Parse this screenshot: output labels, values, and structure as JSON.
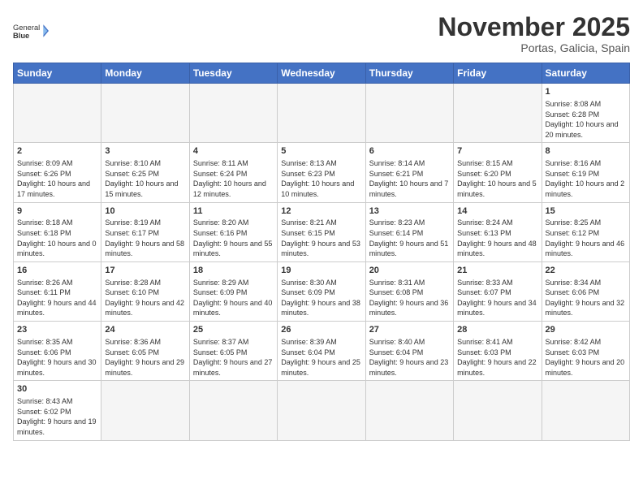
{
  "logo": {
    "text_regular": "General",
    "text_bold": "Blue"
  },
  "header": {
    "month": "November 2025",
    "location": "Portas, Galicia, Spain"
  },
  "days_of_week": [
    "Sunday",
    "Monday",
    "Tuesday",
    "Wednesday",
    "Thursday",
    "Friday",
    "Saturday"
  ],
  "weeks": [
    [
      {
        "day": "",
        "empty": true
      },
      {
        "day": "",
        "empty": true
      },
      {
        "day": "",
        "empty": true
      },
      {
        "day": "",
        "empty": true
      },
      {
        "day": "",
        "empty": true
      },
      {
        "day": "",
        "empty": true
      },
      {
        "day": "1",
        "info": "Sunrise: 8:08 AM\nSunset: 6:28 PM\nDaylight: 10 hours and 20 minutes."
      }
    ],
    [
      {
        "day": "2",
        "info": "Sunrise: 8:09 AM\nSunset: 6:26 PM\nDaylight: 10 hours and 17 minutes."
      },
      {
        "day": "3",
        "info": "Sunrise: 8:10 AM\nSunset: 6:25 PM\nDaylight: 10 hours and 15 minutes."
      },
      {
        "day": "4",
        "info": "Sunrise: 8:11 AM\nSunset: 6:24 PM\nDaylight: 10 hours and 12 minutes."
      },
      {
        "day": "5",
        "info": "Sunrise: 8:13 AM\nSunset: 6:23 PM\nDaylight: 10 hours and 10 minutes."
      },
      {
        "day": "6",
        "info": "Sunrise: 8:14 AM\nSunset: 6:21 PM\nDaylight: 10 hours and 7 minutes."
      },
      {
        "day": "7",
        "info": "Sunrise: 8:15 AM\nSunset: 6:20 PM\nDaylight: 10 hours and 5 minutes."
      },
      {
        "day": "8",
        "info": "Sunrise: 8:16 AM\nSunset: 6:19 PM\nDaylight: 10 hours and 2 minutes."
      }
    ],
    [
      {
        "day": "9",
        "info": "Sunrise: 8:18 AM\nSunset: 6:18 PM\nDaylight: 10 hours and 0 minutes."
      },
      {
        "day": "10",
        "info": "Sunrise: 8:19 AM\nSunset: 6:17 PM\nDaylight: 9 hours and 58 minutes."
      },
      {
        "day": "11",
        "info": "Sunrise: 8:20 AM\nSunset: 6:16 PM\nDaylight: 9 hours and 55 minutes."
      },
      {
        "day": "12",
        "info": "Sunrise: 8:21 AM\nSunset: 6:15 PM\nDaylight: 9 hours and 53 minutes."
      },
      {
        "day": "13",
        "info": "Sunrise: 8:23 AM\nSunset: 6:14 PM\nDaylight: 9 hours and 51 minutes."
      },
      {
        "day": "14",
        "info": "Sunrise: 8:24 AM\nSunset: 6:13 PM\nDaylight: 9 hours and 48 minutes."
      },
      {
        "day": "15",
        "info": "Sunrise: 8:25 AM\nSunset: 6:12 PM\nDaylight: 9 hours and 46 minutes."
      }
    ],
    [
      {
        "day": "16",
        "info": "Sunrise: 8:26 AM\nSunset: 6:11 PM\nDaylight: 9 hours and 44 minutes."
      },
      {
        "day": "17",
        "info": "Sunrise: 8:28 AM\nSunset: 6:10 PM\nDaylight: 9 hours and 42 minutes."
      },
      {
        "day": "18",
        "info": "Sunrise: 8:29 AM\nSunset: 6:09 PM\nDaylight: 9 hours and 40 minutes."
      },
      {
        "day": "19",
        "info": "Sunrise: 8:30 AM\nSunset: 6:09 PM\nDaylight: 9 hours and 38 minutes."
      },
      {
        "day": "20",
        "info": "Sunrise: 8:31 AM\nSunset: 6:08 PM\nDaylight: 9 hours and 36 minutes."
      },
      {
        "day": "21",
        "info": "Sunrise: 8:33 AM\nSunset: 6:07 PM\nDaylight: 9 hours and 34 minutes."
      },
      {
        "day": "22",
        "info": "Sunrise: 8:34 AM\nSunset: 6:06 PM\nDaylight: 9 hours and 32 minutes."
      }
    ],
    [
      {
        "day": "23",
        "info": "Sunrise: 8:35 AM\nSunset: 6:06 PM\nDaylight: 9 hours and 30 minutes."
      },
      {
        "day": "24",
        "info": "Sunrise: 8:36 AM\nSunset: 6:05 PM\nDaylight: 9 hours and 29 minutes."
      },
      {
        "day": "25",
        "info": "Sunrise: 8:37 AM\nSunset: 6:05 PM\nDaylight: 9 hours and 27 minutes."
      },
      {
        "day": "26",
        "info": "Sunrise: 8:39 AM\nSunset: 6:04 PM\nDaylight: 9 hours and 25 minutes."
      },
      {
        "day": "27",
        "info": "Sunrise: 8:40 AM\nSunset: 6:04 PM\nDaylight: 9 hours and 23 minutes."
      },
      {
        "day": "28",
        "info": "Sunrise: 8:41 AM\nSunset: 6:03 PM\nDaylight: 9 hours and 22 minutes."
      },
      {
        "day": "29",
        "info": "Sunrise: 8:42 AM\nSunset: 6:03 PM\nDaylight: 9 hours and 20 minutes."
      }
    ],
    [
      {
        "day": "30",
        "info": "Sunrise: 8:43 AM\nSunset: 6:02 PM\nDaylight: 9 hours and 19 minutes."
      },
      {
        "day": "",
        "empty": true
      },
      {
        "day": "",
        "empty": true
      },
      {
        "day": "",
        "empty": true
      },
      {
        "day": "",
        "empty": true
      },
      {
        "day": "",
        "empty": true
      },
      {
        "day": "",
        "empty": true
      }
    ]
  ]
}
